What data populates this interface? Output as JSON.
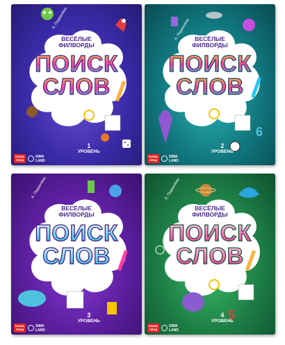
{
  "books": [
    {
      "author": "А. Пиджачёва",
      "subtitle_line1": "ВЕСЁЛЫЕ",
      "subtitle_line2": "ФИЛВОРДЫ",
      "title_line1": "ПОИСК",
      "title_line2": "СЛОВ",
      "level_number": "1",
      "level_word": "УРОВЕНЬ",
      "publisher_logo": "БУКВА ЛЕНД",
      "brand_logo": "SIMA LAND",
      "theme_color": "#3b2aa8"
    },
    {
      "author": "А. Пиджачёва",
      "subtitle_line1": "ВЕСЁЛЫЕ",
      "subtitle_line2": "ФИЛВОРДЫ",
      "title_line1": "ПОИСК",
      "title_line2": "СЛОВ",
      "level_number": "2",
      "level_word": "УРОВЕНЬ",
      "publisher_logo": "БУКВА ЛЕНД",
      "brand_logo": "SIMA LAND",
      "theme_color": "#11777f"
    },
    {
      "author": "А. Пиджачёва",
      "subtitle_line1": "ВЕСЁЛЫЕ",
      "subtitle_line2": "ФИЛВОРДЫ",
      "title_line1": "ПОИСК",
      "title_line2": "СЛОВ",
      "level_number": "3",
      "level_word": "УРОВЕНЬ",
      "publisher_logo": "БУКВА ЛЕНД",
      "brand_logo": "SIMA LAND",
      "theme_color": "#5d1f9f"
    },
    {
      "author": "А. Пиджачёва",
      "subtitle_line1": "ВЕСЁЛЫЕ",
      "subtitle_line2": "ФИЛВОРДЫ",
      "title_line1": "ПОИСК",
      "title_line2": "СЛОВ",
      "level_number": "4",
      "level_word": "УРОВЕНЬ",
      "publisher_logo": "БУКВА ЛЕНД",
      "brand_logo": "SIMA LAND",
      "theme_color": "#1e7f46"
    }
  ],
  "colors": {
    "title_fill_top": "#ff3fa0",
    "title_fill_mid": "#ffd23a",
    "title_fill_bottom": "#29c5f0",
    "cloud": "#ffffff",
    "publisher_logo_bg": "#e02626"
  }
}
